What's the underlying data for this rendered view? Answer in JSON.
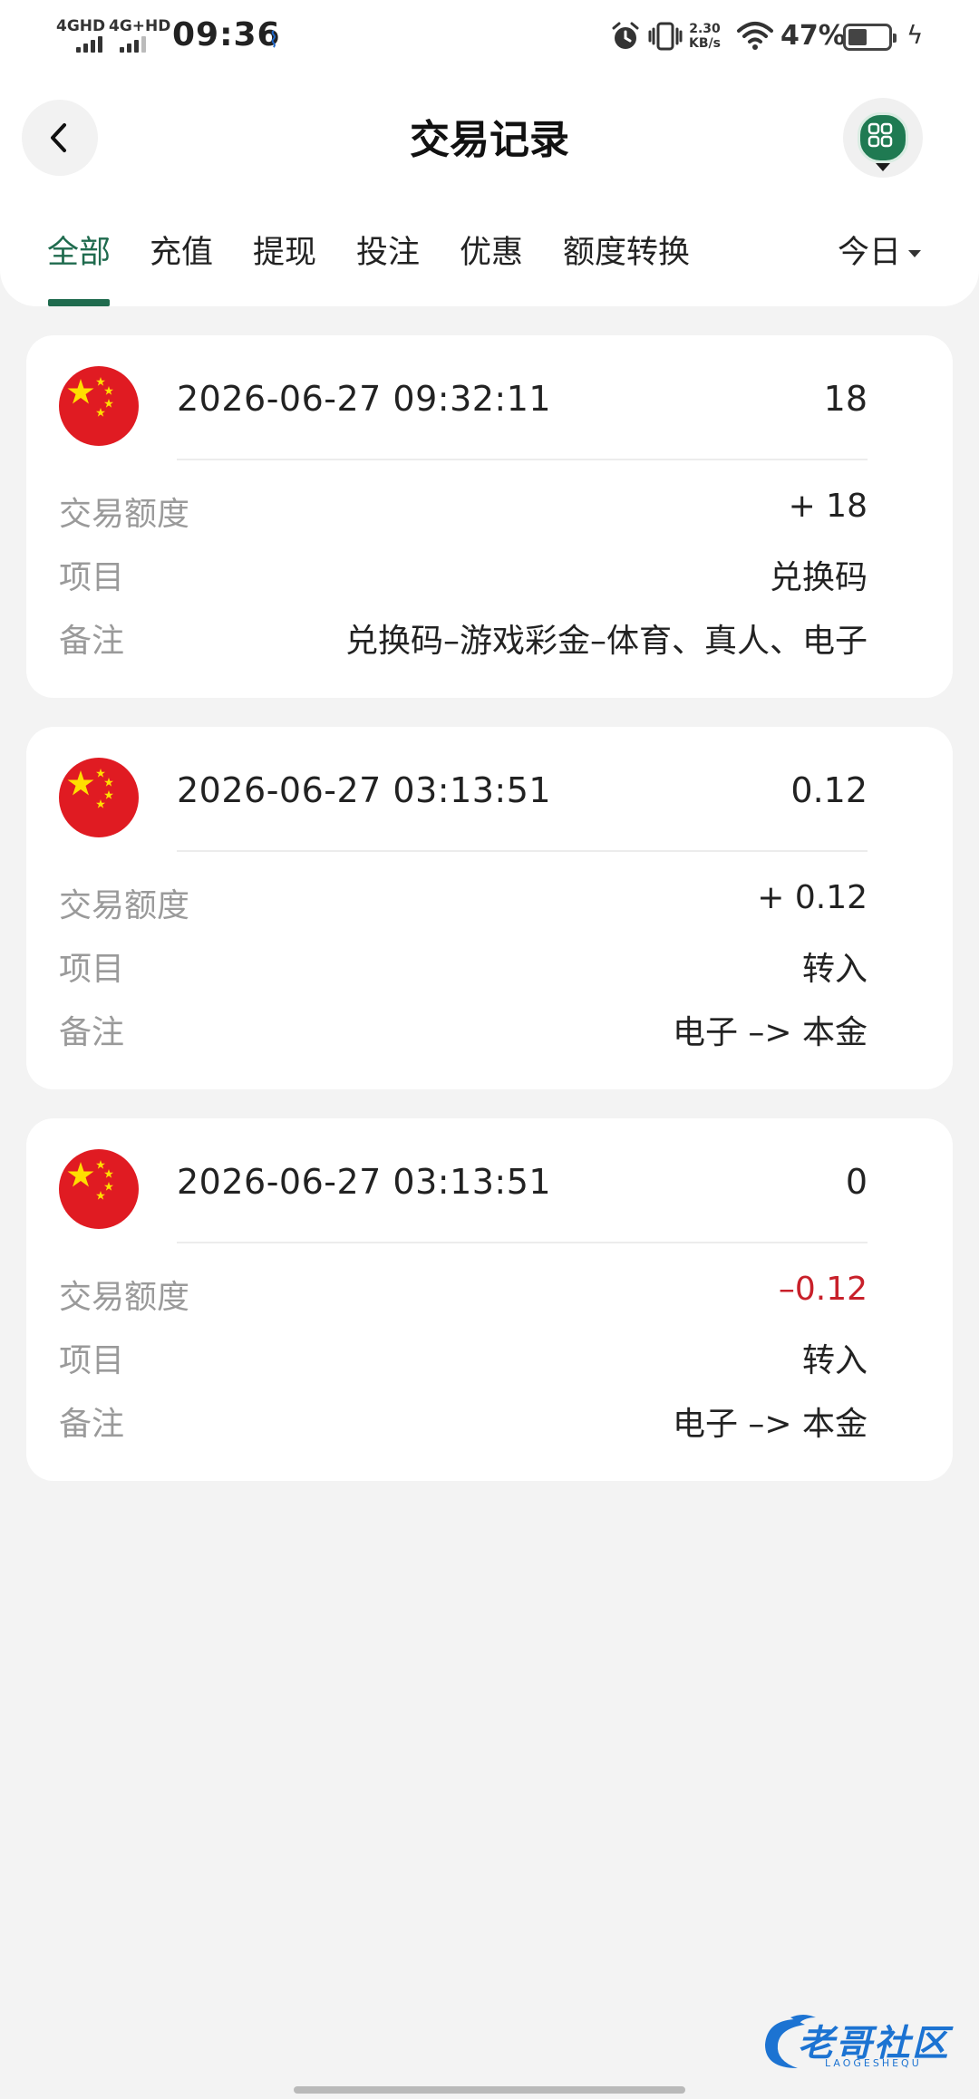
{
  "status_bar": {
    "signal1_label": "4GHD",
    "signal2_label": "4G+HD",
    "time": "09:36",
    "net_speed_value": "2.30",
    "net_speed_unit": "KB/s",
    "battery_percent": "47%",
    "battery_level": 0.47
  },
  "header": {
    "title": "交易记录"
  },
  "tabs": [
    {
      "label": "全部",
      "active": true
    },
    {
      "label": "充值",
      "active": false
    },
    {
      "label": "提现",
      "active": false
    },
    {
      "label": "投注",
      "active": false
    },
    {
      "label": "优惠",
      "active": false
    },
    {
      "label": "额度转换",
      "active": false
    }
  ],
  "date_filter": {
    "label": "今日"
  },
  "records": [
    {
      "time": "2026-06-27 09:32:11",
      "balance": "18",
      "amount_label": "交易额度",
      "amount": "+ 18",
      "amount_negative": false,
      "item_label": "项目",
      "item": "兑换码",
      "note_label": "备注",
      "note": "兑换码–游戏彩金–体育、真人、电子"
    },
    {
      "time": "2026-06-27 03:13:51",
      "balance": "0.12",
      "amount_label": "交易额度",
      "amount": "+ 0.12",
      "amount_negative": false,
      "item_label": "项目",
      "item": "转入",
      "note_label": "备注",
      "note": "电子 –> 本金"
    },
    {
      "time": "2026-06-27 03:13:51",
      "balance": "0",
      "amount_label": "交易额度",
      "amount": "–0.12",
      "amount_negative": true,
      "item_label": "项目",
      "item": "转入",
      "note_label": "备注",
      "note": "电子 –> 本金"
    }
  ],
  "watermark": {
    "text": "老哥社区",
    "sub": "LAOGESHEQU"
  },
  "colors": {
    "accent": "#1f6b4e",
    "negative": "#c8202a",
    "flag_red": "#e01b22",
    "flag_star": "#ffde00"
  },
  "icons": {
    "back": "chevron-left-icon",
    "menu": "grid-menu-icon",
    "flag": "china-flag-icon"
  }
}
